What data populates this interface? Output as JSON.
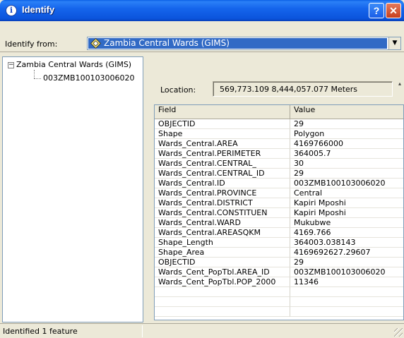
{
  "window": {
    "title": "Identify"
  },
  "toolbar": {
    "identify_from_label": "Identify from:",
    "identify_from_value": "Zambia Central Wards (GIMS)"
  },
  "tree": {
    "root_label": "Zambia Central Wards (GIMS)",
    "child_label": "003ZMB100103006020",
    "toggle": "−"
  },
  "location": {
    "label": "Location:",
    "value": "569,773.109  8,444,057.077 Meters"
  },
  "grid": {
    "columns": [
      "Field",
      "Value"
    ],
    "rows": [
      [
        "OBJECTID",
        "29"
      ],
      [
        "Shape",
        "Polygon"
      ],
      [
        "Wards_Central.AREA",
        "4169766000"
      ],
      [
        "Wards_Central.PERIMETER",
        "364005.7"
      ],
      [
        "Wards_Central.CENTRAL_",
        "30"
      ],
      [
        "Wards_Central.CENTRAL_ID",
        "29"
      ],
      [
        "Wards_Central.ID",
        "003ZMB100103006020"
      ],
      [
        "Wards_Central.PROVINCE",
        "Central"
      ],
      [
        "Wards_Central.DISTRICT",
        "Kapiri Mposhi"
      ],
      [
        "Wards_Central.CONSTITUEN",
        "Kapiri Mposhi"
      ],
      [
        "Wards_Central.WARD",
        "Mukubwe"
      ],
      [
        "Wards_Central.AREASQKM",
        "4169.766"
      ],
      [
        "Shape_Length",
        "364003.038143"
      ],
      [
        "Shape_Area",
        "4169692627.29607"
      ],
      [
        "OBJECTID",
        "29"
      ],
      [
        "Wards_Cent_PopTbl.AREA_ID",
        "003ZMB100103006020"
      ],
      [
        "Wards_Cent_PopTbl.POP_2000",
        "11346"
      ],
      [
        "",
        ""
      ],
      [
        "",
        ""
      ],
      [
        "",
        ""
      ]
    ]
  },
  "status": {
    "text": "Identified 1 feature"
  },
  "icons": {
    "title_icon": "info-icon",
    "layer_icon": "layer-diamond-icon",
    "help": "?",
    "close": "✕",
    "dropdown": "▼"
  },
  "colors": {
    "titlebar": "#0b54dc",
    "selection": "#316ac5",
    "window_bg": "#ece9d8"
  }
}
